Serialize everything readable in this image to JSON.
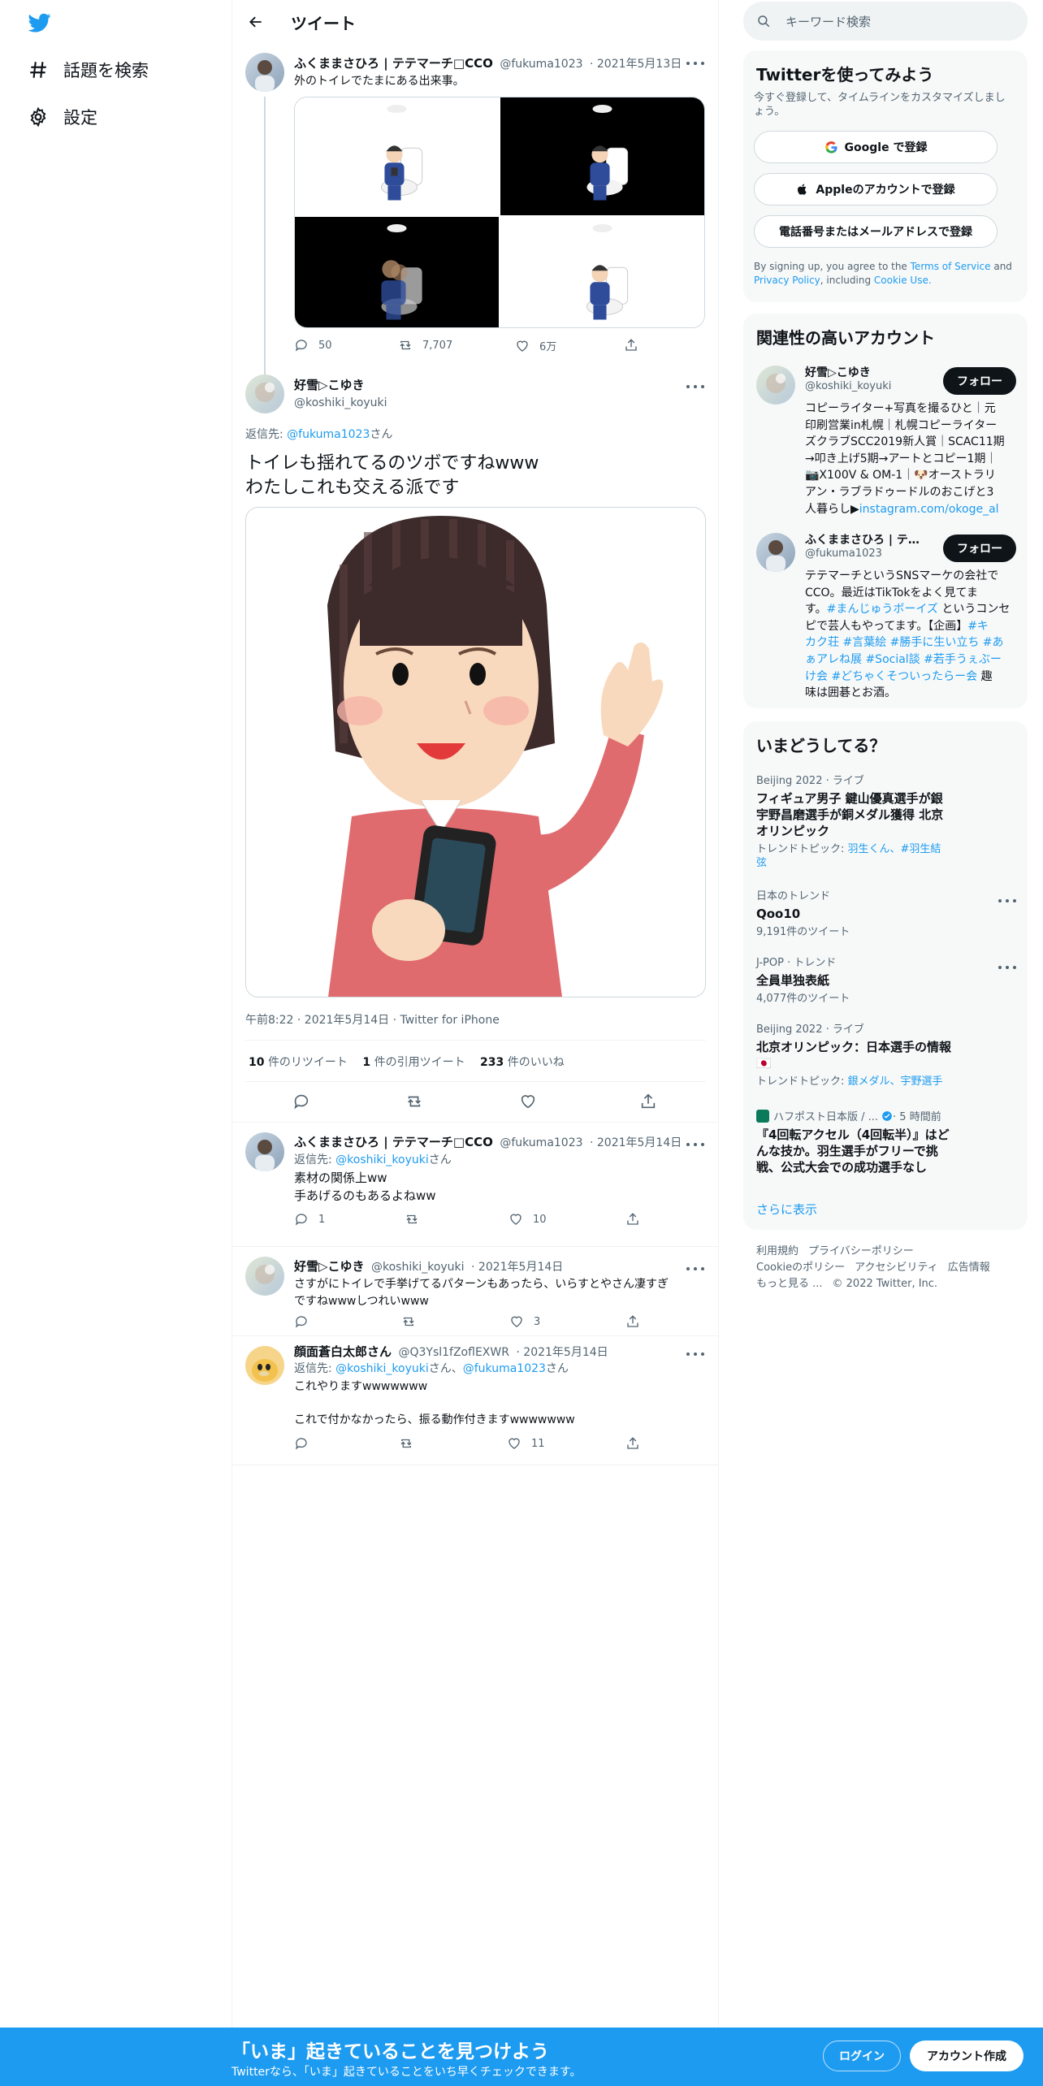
{
  "nav": {
    "explore": "話題を検索",
    "settings": "設定"
  },
  "header": {
    "title": "ツイート"
  },
  "parent_tweet": {
    "name": "ふくままさひろ | テテマーチ□CCO",
    "handle": "@fukuma1023",
    "date": "· 2021年5月13日",
    "text": "外のトイレでたまにある出来事。",
    "replies": "50",
    "retweets": "7,707",
    "likes": "6万"
  },
  "main_tweet": {
    "name": "好雪▷こゆき",
    "handle": "@koshiki_koyuki",
    "reply_prefix": "返信先: ",
    "reply_to": "@fukuma1023",
    "reply_suffix": "さん",
    "line1": "トイレも揺れてるのツボですねwww",
    "line2": "わたしこれも交える派です",
    "timestamp": "午前8:22 · 2021年5月14日 · Twitter for iPhone",
    "stats": {
      "retweets_num": "10",
      "retweets_label": "件のリツイート",
      "quotes_num": "1",
      "quotes_label": "件の引用ツイート",
      "likes_num": "233",
      "likes_label": "件のいいね"
    }
  },
  "replies": [
    {
      "name": "ふくままさひろ | テテマーチ□CCO",
      "handle": "@fukuma1023",
      "date": "· 2021年5月14日",
      "reply_prefix": "返信先: ",
      "reply_to": "@koshiki_koyuki",
      "reply_suffix": "さん",
      "line1": "素材の関係上ww",
      "line2": "手あげるのもあるよねww",
      "replies": "1",
      "retweets": "",
      "likes": "10"
    },
    {
      "name": "好雪▷こゆき",
      "handle": "@koshiki_koyuki",
      "date": "· 2021年5月14日",
      "line1": "さすがにトイレで手挙げてるパターンもあったら、いらすとやさん凄すぎ",
      "line2": "ですねwwwしつれいwww",
      "replies": "",
      "retweets": "",
      "likes": "3"
    },
    {
      "name": "顔面蒼白太郎さん",
      "handle": "@Q3Ysl1fZoflEXWR",
      "date": "· 2021年5月14日",
      "reply_prefix": "返信先: ",
      "reply_to": "@koshiki_koyuki",
      "reply_mid": "さん、",
      "reply_to2": "@fukuma1023",
      "reply_suffix": "さん",
      "line1": "これやりますwwwwwww",
      "line2": "これで付かなかったら、振る動作付きますwwwwwww",
      "replies": "",
      "retweets": "",
      "likes": "11"
    }
  ],
  "search": {
    "placeholder": "キーワード検索"
  },
  "signup": {
    "title": "Twitterを使ってみよう",
    "desc": "今すぐ登録して、タイムラインをカスタマイズしましょう。",
    "google": "Google で登録",
    "apple": "Appleのアカウントで登録",
    "phone": "電話番号またはメールアドレスで登録",
    "terms_pre": "By signing up, you agree to the ",
    "terms": "Terms of Service",
    "terms_and": " and",
    "privacy": "Privacy Policy",
    "including": ", including ",
    "cookie": "Cookie Use."
  },
  "related": {
    "title": "関連性の高いアカウント",
    "follow": "フォロー",
    "accounts": [
      {
        "name": "好雪▷こゆき",
        "handle": "@koshiki_koyuki",
        "bio": [
          "コピーライター+写真を撮るひと｜元",
          "印刷営業in札幌｜札幌コピーライター",
          "ズクラブSCC2019新人賞｜SCAC11期",
          "→叩き上げ5期→アートとコピー1期｜",
          "📷X100V & OM-1｜🐶オーストラリ",
          "アン・ラブラドゥードルのおこげと3",
          "人暮らし▶"
        ],
        "bio_link": "instagram.com/okoge_al"
      },
      {
        "name": "ふくままさひろ | テ…",
        "handle": "@fukuma1023",
        "bio_html_parts": [
          [
            "テテマーチというSNSマーケの会社で",
            ""
          ],
          [
            "CCO。最近はTikTokをよく見てま",
            ""
          ],
          [
            "す。",
            "#まんじゅうボーイズ",
            " というコンセ"
          ],
          [
            "ピで芸人もやってます。【企画】",
            "#キ"
          ],
          [
            "",
            "カク荘 #言葉絵 #勝手に生い立ち #あ"
          ],
          [
            "",
            "ぁアレね展 #Social談 #若手うぇぶー"
          ],
          [
            "",
            "け会 #どちゃくそついったらー会",
            " 趣"
          ],
          [
            "味は囲碁とお酒。",
            ""
          ]
        ]
      }
    ]
  },
  "trends": {
    "title": "いまどうしてる？",
    "items": [
      {
        "ctx": "Beijing 2022 · ライブ",
        "title": "フィギュア男子 鍵山優真選手が銀 宇野昌磨選手が銅メダル獲得 北京オリンピック",
        "sub_pre": "トレンドトピック: ",
        "sub_link": "羽生くん、#羽生結弦"
      },
      {
        "ctx": "日本のトレンド",
        "title": "Qoo10",
        "sub": "9,191件のツイート"
      },
      {
        "ctx": "J-POP · トレンド",
        "title": "全員単独表紙",
        "sub": "4,077件のツイート"
      },
      {
        "ctx": "Beijing 2022 · ライブ",
        "title": "北京オリンピック：日本選手の情報🇯🇵",
        "sub_pre": "トレンドトピック: ",
        "sub_link": "銀メダル、宇野選手"
      },
      {
        "ctx": "ハフポスト日本版 / ...",
        "ctx_time": " · 5 時間前",
        "title": "『4回転アクセル（4回転半）』はどんな技か。羽生選手がフリーで挑戦、公式大会での成功選手なし"
      }
    ],
    "show_more": "さらに表示"
  },
  "footer": {
    "links": [
      "利用規約",
      "プライバシーポリシー",
      "Cookieのポリシー",
      "アクセシビリティ",
      "広告情報",
      "もっと見る ...",
      "© 2022 Twitter, Inc."
    ]
  },
  "bottombar": {
    "title": "「いま」起きていることを見つけよう",
    "sub": "Twitterなら、「いま」起きていることをいち早くチェックできます。",
    "login": "ログイン",
    "signup": "アカウント作成"
  },
  "colors": {
    "accent": "#1d9bf0",
    "text": "#0f1419",
    "muted": "#536471",
    "border": "#eff3f4",
    "card": "#f7f9f9"
  }
}
